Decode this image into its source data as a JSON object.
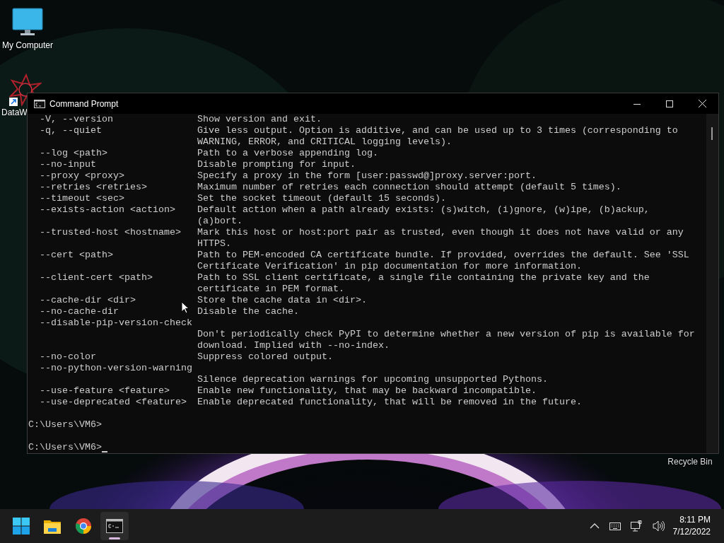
{
  "desktop": {
    "icons": [
      {
        "kind": "computer",
        "label": "My Computer"
      },
      {
        "kind": "app",
        "label": "DataW"
      },
      {
        "kind": "recycle",
        "label": "Recycle Bin"
      }
    ]
  },
  "window": {
    "title": "Command Prompt",
    "options": [
      {
        "kind": "inline",
        "option": "-V, --version",
        "description": [
          "Show version and exit."
        ]
      },
      {
        "kind": "inline",
        "option": "-q, --quiet",
        "description": [
          "Give less output. Option is additive, and can be used up to 3 times (corresponding to",
          "WARNING, ERROR, and CRITICAL logging levels)."
        ]
      },
      {
        "kind": "inline",
        "option": "--log <path>",
        "description": [
          "Path to a verbose appending log."
        ]
      },
      {
        "kind": "inline",
        "option": "--no-input",
        "description": [
          "Disable prompting for input."
        ]
      },
      {
        "kind": "inline",
        "option": "--proxy <proxy>",
        "description": [
          "Specify a proxy in the form [user:passwd@]proxy.server:port."
        ]
      },
      {
        "kind": "inline",
        "option": "--retries <retries>",
        "description": [
          "Maximum number of retries each connection should attempt (default 5 times)."
        ]
      },
      {
        "kind": "inline",
        "option": "--timeout <sec>",
        "description": [
          "Set the socket timeout (default 15 seconds)."
        ]
      },
      {
        "kind": "inline",
        "option": "--exists-action <action>",
        "description": [
          "Default action when a path already exists: (s)witch, (i)gnore, (w)ipe, (b)ackup,",
          "(a)bort."
        ]
      },
      {
        "kind": "inline",
        "option": "--trusted-host <hostname>",
        "description": [
          "Mark this host or host:port pair as trusted, even though it does not have valid or any",
          "HTTPS."
        ]
      },
      {
        "kind": "inline",
        "option": "--cert <path>",
        "description": [
          "Path to PEM-encoded CA certificate bundle. If provided, overrides the default. See 'SSL",
          "Certificate Verification' in pip documentation for more information."
        ]
      },
      {
        "kind": "inline",
        "option": "--client-cert <path>",
        "description": [
          "Path to SSL client certificate, a single file containing the private key and the",
          "certificate in PEM format."
        ]
      },
      {
        "kind": "inline",
        "option": "--cache-dir <dir>",
        "description": [
          "Store the cache data in <dir>."
        ]
      },
      {
        "kind": "inline",
        "option": "--no-cache-dir",
        "description": [
          "Disable the cache."
        ]
      },
      {
        "kind": "below",
        "option": "--disable-pip-version-check",
        "description": [
          "Don't periodically check PyPI to determine whether a new version of pip is available for",
          "download. Implied with --no-index."
        ]
      },
      {
        "kind": "inline",
        "option": "--no-color",
        "description": [
          "Suppress colored output."
        ]
      },
      {
        "kind": "below",
        "option": "--no-python-version-warning",
        "description": [
          "Silence deprecation warnings for upcoming unsupported Pythons."
        ]
      },
      {
        "kind": "inline",
        "option": "--use-feature <feature>",
        "description": [
          "Enable new functionality, that may be backward incompatible."
        ]
      },
      {
        "kind": "inline",
        "option": "--use-deprecated <feature>",
        "description": [
          "Enable deprecated functionality, that will be removed in the future."
        ]
      }
    ],
    "prompts": [
      "C:\\Users\\VM6>",
      "C:\\Users\\VM6>"
    ]
  },
  "taskbar": {
    "apps": [
      {
        "kind": "start",
        "selected": false
      },
      {
        "kind": "explorer",
        "selected": false
      },
      {
        "kind": "chrome",
        "selected": false
      },
      {
        "kind": "terminal",
        "selected": true
      }
    ],
    "tray": [
      {
        "kind": "chevron"
      },
      {
        "kind": "keyboard"
      },
      {
        "kind": "network"
      },
      {
        "kind": "volume"
      }
    ],
    "time": "8:11 PM",
    "date": "7/12/2022"
  }
}
